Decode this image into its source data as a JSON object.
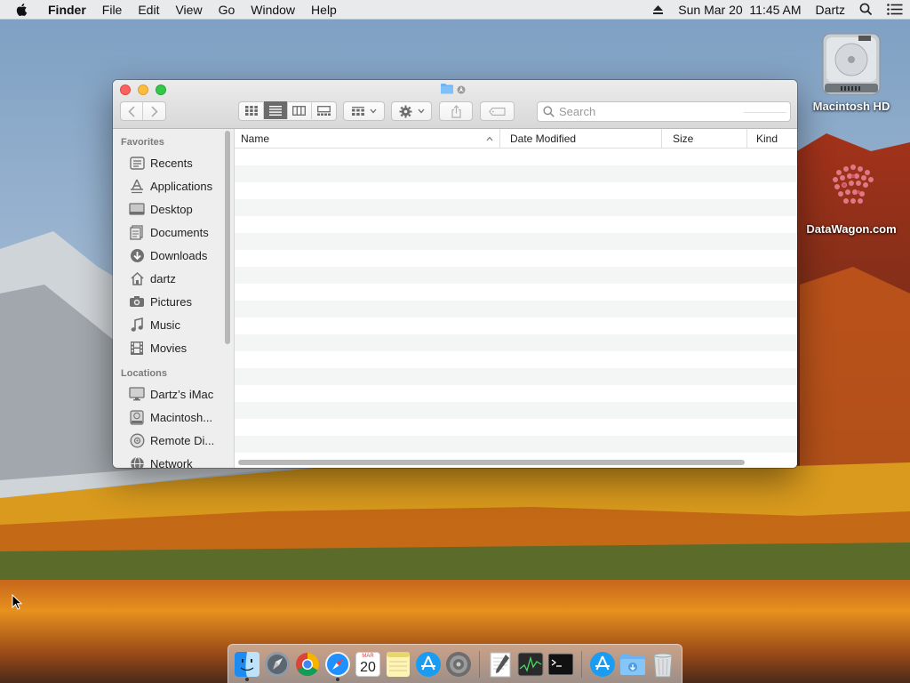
{
  "menubar": {
    "app_name": "Finder",
    "menus": [
      "File",
      "Edit",
      "View",
      "Go",
      "Window",
      "Help"
    ],
    "clock": "Sun Mar 20  11:45 AM",
    "user": "Dartz"
  },
  "desktop": {
    "icons": [
      {
        "label": "Macintosh HD",
        "icon": "hard-drive-icon"
      },
      {
        "label": "DataWagon.com",
        "icon": "datawagon-logo-icon"
      }
    ]
  },
  "finder": {
    "toolbar": {
      "search_placeholder": "Search"
    },
    "sidebar": {
      "favorites_title": "Favorites",
      "favorites": [
        {
          "label": "Recents",
          "icon": "recents-icon"
        },
        {
          "label": "Applications",
          "icon": "applications-icon"
        },
        {
          "label": "Desktop",
          "icon": "desktop-icon"
        },
        {
          "label": "Documents",
          "icon": "documents-icon"
        },
        {
          "label": "Downloads",
          "icon": "downloads-icon"
        },
        {
          "label": "dartz",
          "icon": "home-icon"
        },
        {
          "label": "Pictures",
          "icon": "pictures-icon"
        },
        {
          "label": "Music",
          "icon": "music-icon"
        },
        {
          "label": "Movies",
          "icon": "movies-icon"
        }
      ],
      "locations_title": "Locations",
      "locations": [
        {
          "label": "Dartz’s iMac",
          "icon": "imac-icon"
        },
        {
          "label": "Macintosh...",
          "icon": "disk-icon"
        },
        {
          "label": "Remote Di...",
          "icon": "remote-disc-icon"
        },
        {
          "label": "Network",
          "icon": "network-icon"
        }
      ]
    },
    "columns": [
      "Name",
      "Date Modified",
      "Size",
      "Kind"
    ]
  },
  "dock": {
    "apps": [
      "finder",
      "launchpad",
      "chrome",
      "safari",
      "calendar",
      "notes",
      "app-store",
      "system-preferences",
      "textedit",
      "activity-monitor",
      "terminal",
      "app-store-2",
      "downloads-folder",
      "trash"
    ],
    "calendar_day": "20",
    "calendar_month": "MAR"
  },
  "colors": {
    "close": "#fc615d",
    "minimize": "#fdbc40",
    "zoom": "#34c84a",
    "folder": "#6cb3f3"
  }
}
